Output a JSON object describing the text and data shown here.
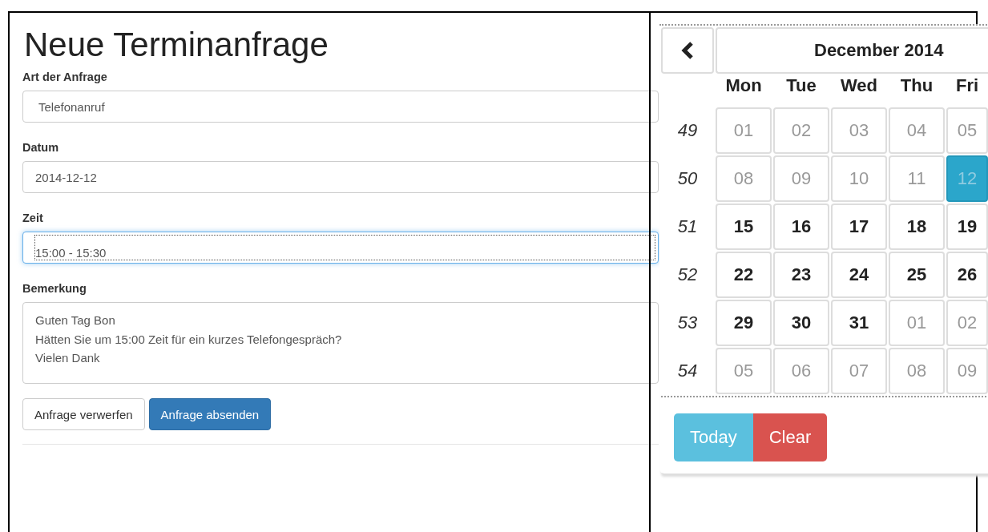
{
  "title": "Neue Terminanfrage",
  "fields": [
    {
      "kind": "select",
      "label": "Art der Anfrage",
      "value": "Telefonanruf",
      "focused": false
    },
    {
      "kind": "input",
      "label": "Datum",
      "value": "2014-12-12",
      "focused": false
    },
    {
      "kind": "select",
      "label": "Zeit",
      "value": "15:00 - 15:30",
      "focused": true
    },
    {
      "kind": "textarea",
      "label": "Bemerkung",
      "value": "Guten Tag Bon\nHätten Sie um 15:00 Zeit für ein kurzes Telefongespräch?\nVielen Dank",
      "focused": false
    }
  ],
  "buttons": [
    {
      "label": "Anfrage verwerfen",
      "kind": "default"
    },
    {
      "label": "Anfrage absenden",
      "kind": "primary"
    }
  ],
  "datepicker": {
    "month": "December 2014",
    "weekdays": [
      "Mon",
      "Tue",
      "Wed",
      "Thu",
      "Fri"
    ],
    "weeks": [
      {
        "number": "49",
        "days": [
          {
            "label": "01",
            "muted": true,
            "selected": false
          },
          {
            "label": "02",
            "muted": true,
            "selected": false
          },
          {
            "label": "03",
            "muted": true,
            "selected": false
          },
          {
            "label": "04",
            "muted": true,
            "selected": false
          },
          {
            "label": "05",
            "muted": true,
            "selected": false
          }
        ]
      },
      {
        "number": "50",
        "days": [
          {
            "label": "08",
            "muted": true,
            "selected": false
          },
          {
            "label": "09",
            "muted": true,
            "selected": false
          },
          {
            "label": "10",
            "muted": true,
            "selected": false
          },
          {
            "label": "11",
            "muted": true,
            "selected": false
          },
          {
            "label": "12",
            "muted": true,
            "selected": true
          }
        ]
      },
      {
        "number": "51",
        "days": [
          {
            "label": "15",
            "muted": false,
            "selected": false
          },
          {
            "label": "16",
            "muted": false,
            "selected": false
          },
          {
            "label": "17",
            "muted": false,
            "selected": false
          },
          {
            "label": "18",
            "muted": false,
            "selected": false
          },
          {
            "label": "19",
            "muted": false,
            "selected": false
          }
        ]
      },
      {
        "number": "52",
        "days": [
          {
            "label": "22",
            "muted": false,
            "selected": false
          },
          {
            "label": "23",
            "muted": false,
            "selected": false
          },
          {
            "label": "24",
            "muted": false,
            "selected": false
          },
          {
            "label": "25",
            "muted": false,
            "selected": false
          },
          {
            "label": "26",
            "muted": false,
            "selected": false
          }
        ]
      },
      {
        "number": "53",
        "days": [
          {
            "label": "29",
            "muted": false,
            "selected": false
          },
          {
            "label": "30",
            "muted": false,
            "selected": false
          },
          {
            "label": "31",
            "muted": false,
            "selected": false
          },
          {
            "label": "01",
            "muted": true,
            "selected": false
          },
          {
            "label": "02",
            "muted": true,
            "selected": false
          }
        ]
      },
      {
        "number": "54",
        "days": [
          {
            "label": "05",
            "muted": true,
            "selected": false
          },
          {
            "label": "06",
            "muted": true,
            "selected": false
          },
          {
            "label": "07",
            "muted": true,
            "selected": false
          },
          {
            "label": "08",
            "muted": true,
            "selected": false
          },
          {
            "label": "09",
            "muted": true,
            "selected": false
          }
        ]
      }
    ],
    "footer_buttons": [
      {
        "label": "Today",
        "kind": "info"
      },
      {
        "label": "Clear",
        "kind": "danger"
      }
    ]
  }
}
